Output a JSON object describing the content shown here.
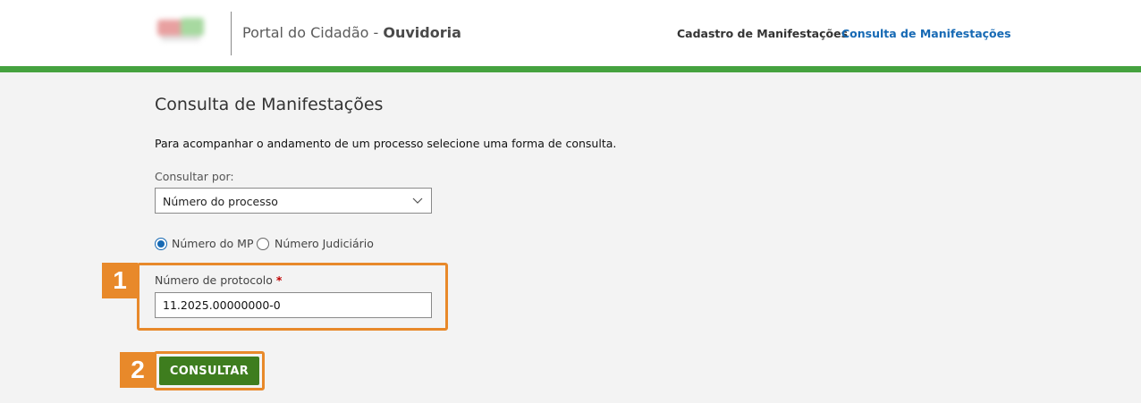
{
  "header": {
    "portal_prefix": "Portal do Cidadão - ",
    "portal_name": "Ouvidoria",
    "nav": [
      {
        "label": "Cadastro de Manifestações"
      },
      {
        "label": "Consulta de Manifestações"
      }
    ]
  },
  "main": {
    "title": "Consulta de Manifestações",
    "intro": "Para acompanhar o andamento de um processo selecione uma forma de consulta.",
    "consultar_label": "Consultar por:",
    "consultar_value": "Número do processo",
    "radios": [
      {
        "label": "Número do MP",
        "checked": true
      },
      {
        "label": "Número Judiciário",
        "checked": false
      }
    ],
    "protocolo_label": "Número de protocolo",
    "required_mark": "*",
    "protocolo_value": "11.2025.00000000-0",
    "submit_label": "CONSULTAR"
  },
  "annotations": {
    "step1": "1",
    "step2": "2"
  },
  "colors": {
    "accent_green": "#45a23f",
    "button_green": "#3e7d1e",
    "link_blue": "#1669b4",
    "highlight_orange": "#e8892a"
  }
}
